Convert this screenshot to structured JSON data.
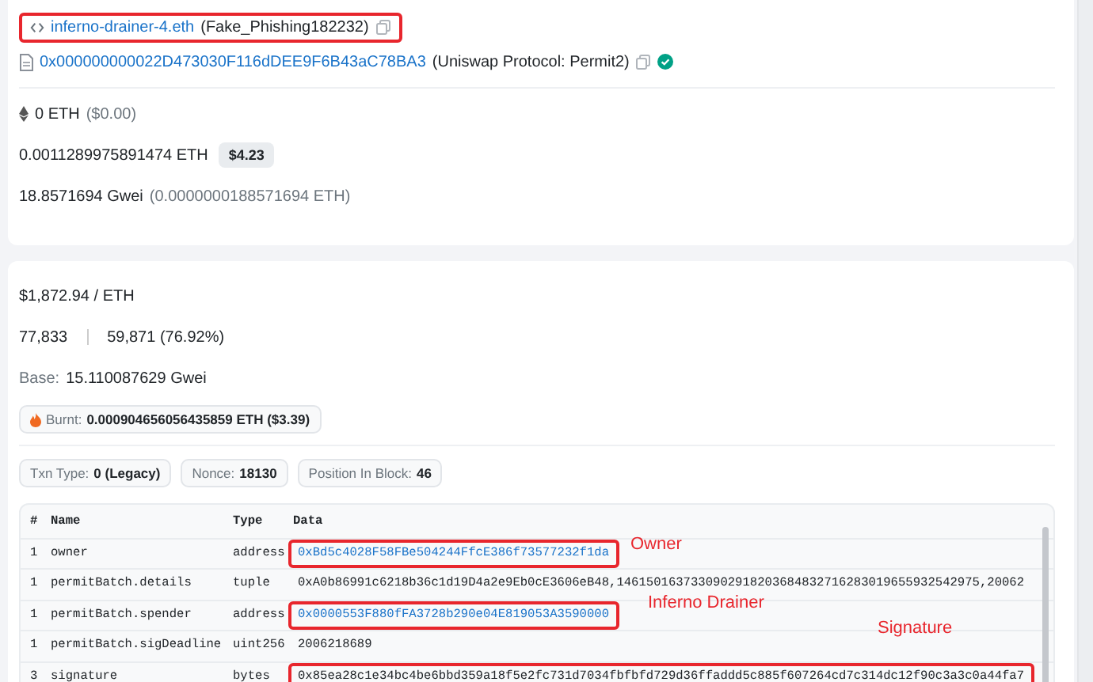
{
  "from": {
    "name": "inferno-drainer-4.eth",
    "label": "(Fake_Phishing182232)",
    "highlighted": true
  },
  "to": {
    "address": "0x000000000022D473030F116dDEE9F6B43aC78BA3",
    "label": "(Uniswap Protocol: Permit2)",
    "verified": true
  },
  "value": {
    "amount": "0 ETH",
    "usd": "($0.00)"
  },
  "fee": {
    "amount": "0.0011289975891474 ETH",
    "usd": "$4.23"
  },
  "gas_price": {
    "gwei": "18.8571694 Gwei",
    "eth": "(0.0000000188571694 ETH)"
  },
  "eth_price": "$1,872.94 / ETH",
  "gas": {
    "limit": "77,833",
    "used": "59,871 (76.92%)"
  },
  "base": {
    "label": "Base:",
    "value": "15.110087629 Gwei"
  },
  "burnt": {
    "label": "Burnt:",
    "value": "0.000904656056435859 ETH ($3.39)"
  },
  "attributes": [
    {
      "label": "Txn Type:",
      "value": "0 (Legacy)"
    },
    {
      "label": "Nonce:",
      "value": "18130"
    },
    {
      "label": "Position In Block:",
      "value": "46"
    }
  ],
  "input_table": {
    "columns": [
      "#",
      "Name",
      "Type",
      "Data"
    ],
    "rows": [
      {
        "index": "1",
        "name": "owner",
        "type": "address",
        "data": "0xBd5c4028F58FBe504244FfcE386f73577232f1da",
        "kind": "link",
        "highlighted": true
      },
      {
        "index": "1",
        "name": "permitBatch.details",
        "type": "tuple",
        "data": "0xA0b86991c6218b36c1d19D4a2e9Eb0cE3606eB48,1461501637330902918203684832716283019655932542975,20062",
        "kind": "plain",
        "highlighted": false
      },
      {
        "index": "1",
        "name": "permitBatch.spender",
        "type": "address",
        "data": "0x0000553F880fFA3728b290e04E819053A3590000",
        "kind": "link",
        "highlighted": true
      },
      {
        "index": "1",
        "name": "permitBatch.sigDeadline",
        "type": "uint256",
        "data": "2006218689",
        "kind": "plain",
        "highlighted": false
      },
      {
        "index": "3",
        "name": "signature",
        "type": "bytes",
        "data": "0x85ea28c1e34bc4be6bbd359a18f5e2fc731d7034fbfbfd729d36ffaddd5c885f607264cd7c314dc12f90c3a3c0a44fa7",
        "kind": "plain",
        "highlighted": true
      }
    ]
  },
  "annotations": [
    "Owner",
    "Inferno Drainer",
    "Signature"
  ]
}
